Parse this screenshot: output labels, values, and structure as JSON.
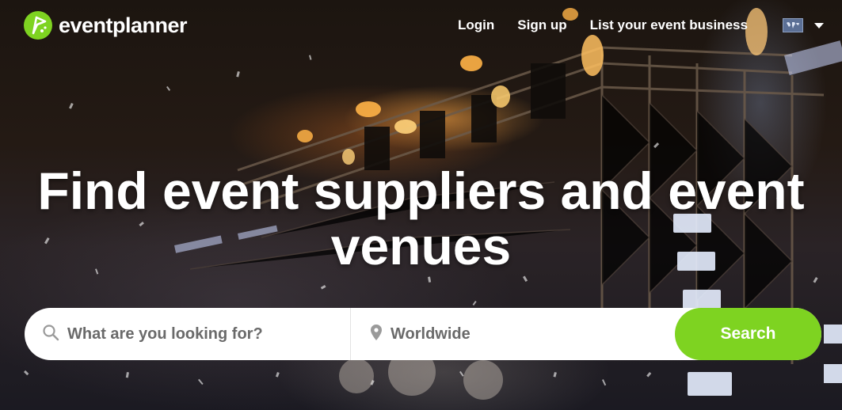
{
  "brand": {
    "name": "eventplanner",
    "accent": "#7ed321"
  },
  "nav": {
    "login": "Login",
    "signup": "Sign up",
    "list_business": "List your event business",
    "language_icon": "world-map-flag-icon"
  },
  "headline": {
    "part1": "Find ",
    "part2": "event suppliers",
    "part3": " and ",
    "part4": "event venues"
  },
  "search": {
    "what_placeholder": "What are you looking for?",
    "where_placeholder": "Worldwide",
    "button_label": "Search"
  }
}
